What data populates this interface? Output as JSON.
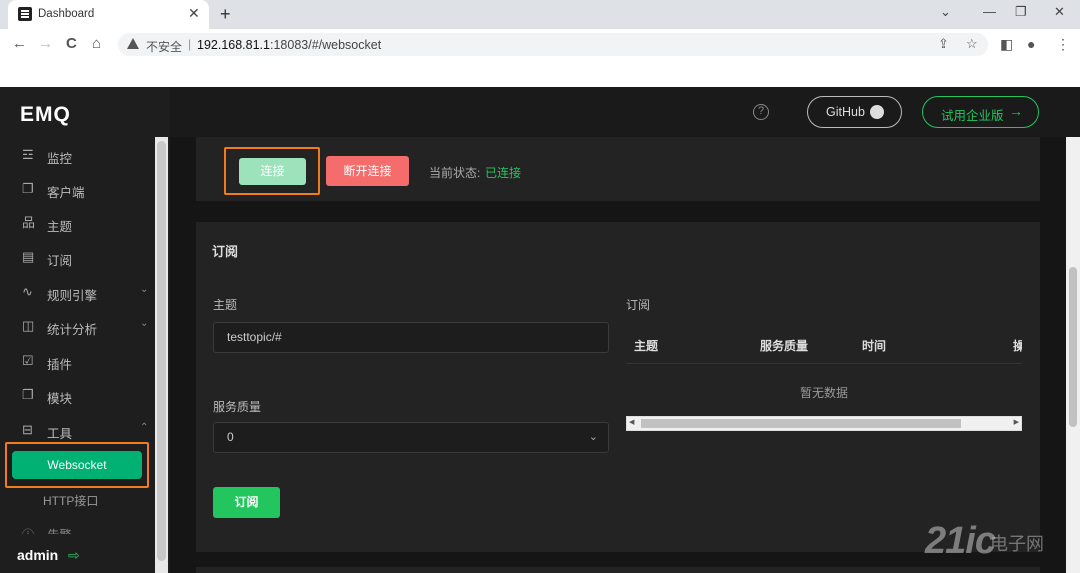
{
  "browser": {
    "tab_title": "Dashboard",
    "tab_close": "✕",
    "new_tab": "+",
    "win_min": "⌄",
    "win_min2": "—",
    "win_restore": "❐",
    "win_close": "✕",
    "back": "←",
    "forward": "→",
    "reload": "C",
    "home": "⌂",
    "insecure_label": "不安全",
    "separator": "|",
    "url_host": "192.168.81.1",
    "url_rest": ":18083/#/websocket"
  },
  "sidebar": {
    "logo": "EMQ",
    "items": [
      {
        "icon": "☲",
        "label": "监控"
      },
      {
        "icon": "❐",
        "label": "客户端"
      },
      {
        "icon": "品",
        "label": "主题"
      },
      {
        "icon": "▤",
        "label": "订阅"
      },
      {
        "icon": "∿",
        "label": "规则引擎",
        "arrow": "⌄"
      },
      {
        "icon": "◫",
        "label": "统计分析",
        "arrow": "⌄"
      },
      {
        "icon": "☑",
        "label": "插件"
      },
      {
        "icon": "❒",
        "label": "模块"
      },
      {
        "icon": "⊟",
        "label": "工具",
        "arrow": "⌃"
      }
    ],
    "sub_active": "Websocket",
    "sub_http": "HTTP接口",
    "cut_item": "告警",
    "user": "admin"
  },
  "header": {
    "help": "?",
    "github_label": "GitHub",
    "enterprise_label": "试用企业版",
    "enterprise_arrow": "→"
  },
  "connection": {
    "connect_label": "连接",
    "disconnect_label": "断开连接",
    "status_label": "当前状态:",
    "status_value": "已连接"
  },
  "subscribe": {
    "title": "订阅",
    "topic_label": "主题",
    "topic_value": "testtopic/#",
    "qos_label": "服务质量",
    "qos_value": "0",
    "qos_arrow": "⌄",
    "subscribe_button": "订阅",
    "list_title": "订阅",
    "columns": [
      "主题",
      "服务质量",
      "时间",
      "操"
    ],
    "empty_text": "暂无数据",
    "scroll_left": "◀",
    "scroll_right": "▶"
  },
  "watermark": {
    "main": "21ic",
    "sub": "电子网"
  },
  "colors": {
    "accent": "#22c55e",
    "danger": "#f56c6c",
    "highlight": "#f07c1c"
  }
}
